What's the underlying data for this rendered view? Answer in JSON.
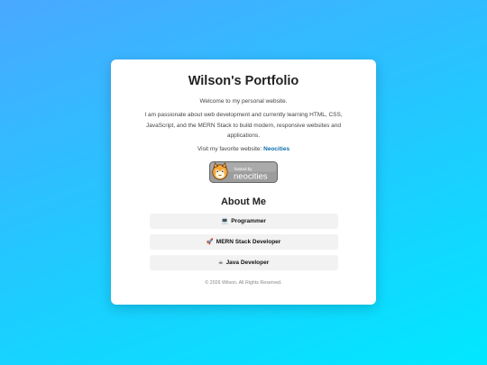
{
  "header": {
    "title": "Wilson's Portfolio"
  },
  "intro": {
    "welcome": "Welcome to my personal website.",
    "description": "I am passionate about web development and currently learning HTML, CSS, JavaScript, and the MERN Stack to build modern, responsive websites and applications.",
    "visit_prefix": "Visit my favorite website: ",
    "visit_link": "Neocities"
  },
  "badge": {
    "small_text": "hosted by",
    "brand_text": "neocities"
  },
  "about": {
    "heading": "About Me",
    "items": [
      {
        "icon": "laptop-icon",
        "glyph": "💻",
        "label": "Programmer"
      },
      {
        "icon": "rocket-icon",
        "glyph": "🚀",
        "label": "MERN Stack Developer"
      },
      {
        "icon": "coffee-icon",
        "glyph": "☕",
        "label": "Java Developer"
      }
    ]
  },
  "footer": {
    "text": "© 2026 Wilson. All Rights Reserved."
  },
  "colors": {
    "link": "#0b6ea8",
    "background_start": "#4aa8ff",
    "background_end": "#00e8ff"
  }
}
